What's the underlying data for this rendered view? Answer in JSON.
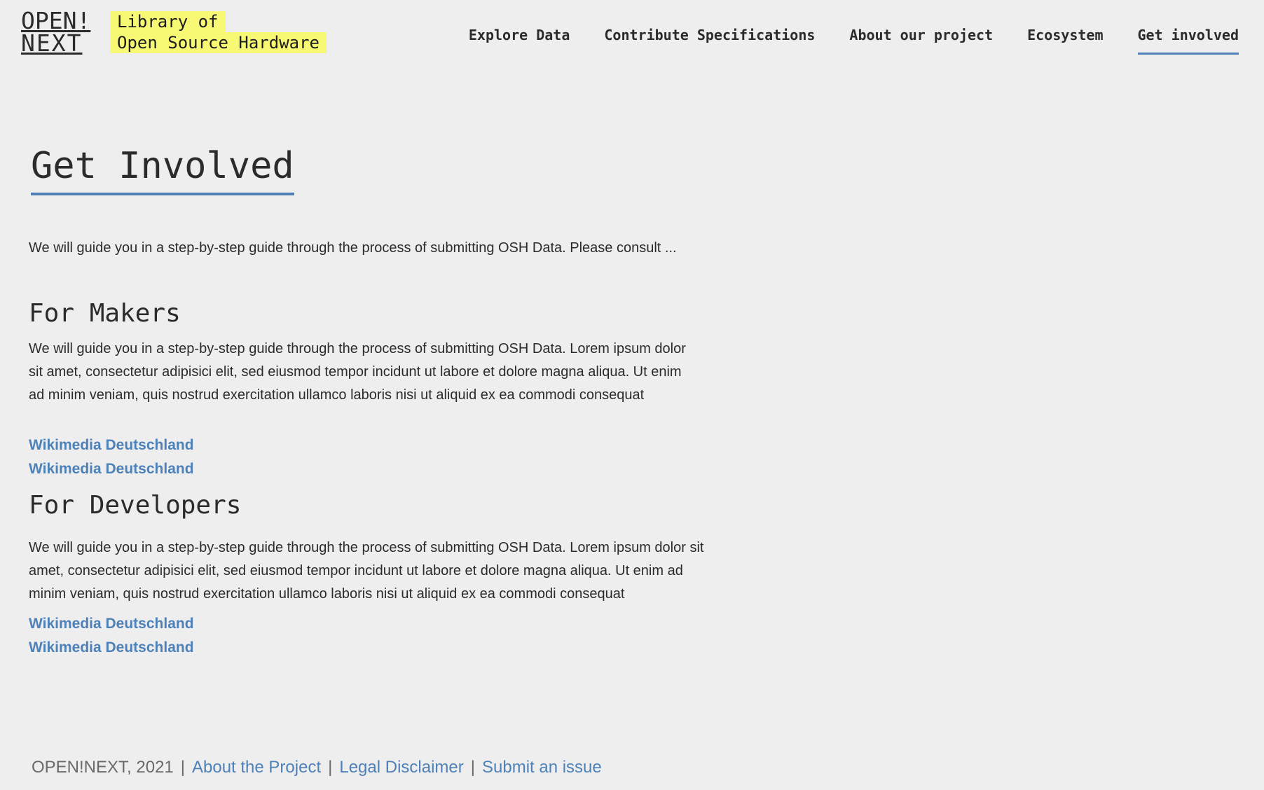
{
  "header": {
    "logo_line1": "OPEN!",
    "logo_line2": "NEXT",
    "tagline_line1": "Library of",
    "tagline_line2": "Open Source Hardware",
    "nav": [
      {
        "label": "Explore Data",
        "active": false
      },
      {
        "label": "Contribute Specifications",
        "active": false
      },
      {
        "label": "About our project",
        "active": false
      },
      {
        "label": "Ecosystem",
        "active": false
      },
      {
        "label": "Get involved",
        "active": true
      }
    ]
  },
  "main": {
    "title": "Get Involved",
    "intro": "We will guide you in a step-by-step guide through the process of submitting OSH Data. Please consult ...",
    "makers": {
      "title": "For Makers",
      "body": "We will guide you in a step-by-step guide through the process of submitting OSH Data. Lorem ipsum dolor sit amet, consectetur adipisici elit, sed eiusmod tempor incidunt ut labore et dolore magna aliqua. Ut enim ad minim veniam, quis nostrud exercitation ullamco laboris nisi ut aliquid ex ea commodi consequat",
      "links": [
        "Wikimedia Deutschland",
        "Wikimedia Deutschland"
      ]
    },
    "developers": {
      "title": "For Developers",
      "body": "We will guide you in a step-by-step guide through the process of submitting OSH Data. Lorem ipsum dolor sit amet, consectetur adipisici elit, sed eiusmod tempor incidunt ut labore et dolore magna aliqua. Ut enim ad minim veniam, quis nostrud exercitation ullamco laboris nisi ut aliquid ex ea commodi consequat",
      "links": [
        "Wikimedia Deutschland",
        "Wikimedia Deutschland"
      ]
    }
  },
  "footer": {
    "copyright": "OPEN!NEXT, 2021",
    "separator": "|",
    "links": [
      "About the Project",
      "Legal Disclaimer",
      "Submit an issue"
    ]
  },
  "colors": {
    "background": "#eeeeee",
    "accent": "#4e81b8",
    "highlight": "#f7f975",
    "text": "#2b2b2b"
  }
}
